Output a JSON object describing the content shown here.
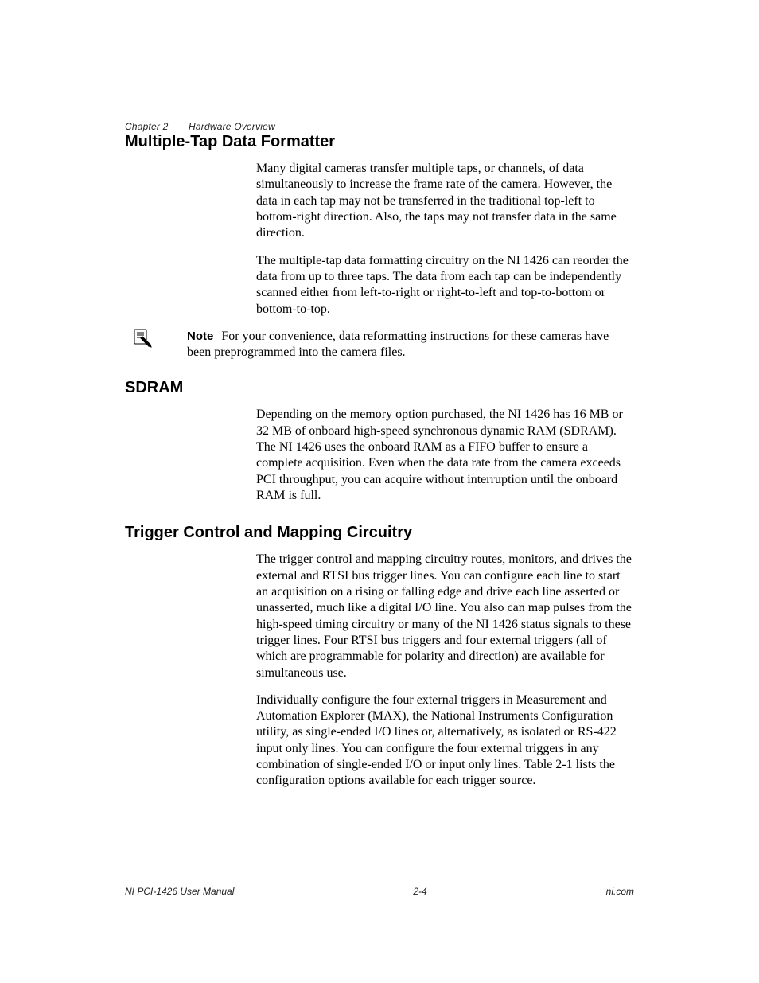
{
  "header": {
    "chapter": "Chapter 2",
    "title": "Hardware Overview"
  },
  "sections": {
    "multitap": {
      "heading": "Multiple-Tap Data Formatter",
      "p1": "Many digital cameras transfer multiple taps, or channels, of data simultaneously to increase the frame rate of the camera. However, the data in each tap may not be transferred in the traditional top-left to bottom-right direction. Also, the taps may not transfer data in the same direction.",
      "p2": "The multiple-tap data formatting circuitry on the NI 1426 can reorder the data from up to three taps. The data from each tap can be independently scanned either from left-to-right or right-to-left and top-to-bottom or bottom-to-top."
    },
    "note": {
      "label": "Note",
      "text": "For your convenience, data reformatting instructions for these cameras have been preprogrammed into the camera files."
    },
    "sdram": {
      "heading": "SDRAM",
      "p1": "Depending on the memory option purchased, the NI 1426 has 16 MB or 32 MB of onboard high-speed synchronous dynamic RAM (SDRAM). The NI 1426 uses the onboard RAM as a FIFO buffer to ensure a complete acquisition. Even when the data rate from the camera exceeds PCI throughput, you can acquire without interruption until the onboard RAM is full."
    },
    "trigger": {
      "heading": "Trigger Control and Mapping Circuitry",
      "p1": "The trigger control and mapping circuitry routes, monitors, and drives the external and RTSI bus trigger lines. You can configure each line to start an acquisition on a rising or falling edge and drive each line asserted or unasserted, much like a digital I/O line. You also can map pulses from the high-speed timing circuitry or many of the NI 1426 status signals to these trigger lines. Four RTSI bus triggers and four external triggers (all of which are programmable for polarity and direction) are available for simultaneous use.",
      "p2": "Individually configure the four external triggers in Measurement and Automation Explorer (MAX), the National Instruments Configuration utility, as single-ended I/O lines or, alternatively, as isolated or RS-422 input only lines. You can configure the four external triggers in any combination of single-ended I/O or input only lines. Table 2-1 lists the configuration options available for each trigger source."
    }
  },
  "footer": {
    "manual": "NI PCI-1426 User Manual",
    "pagenum": "2-4",
    "site": "ni.com"
  }
}
